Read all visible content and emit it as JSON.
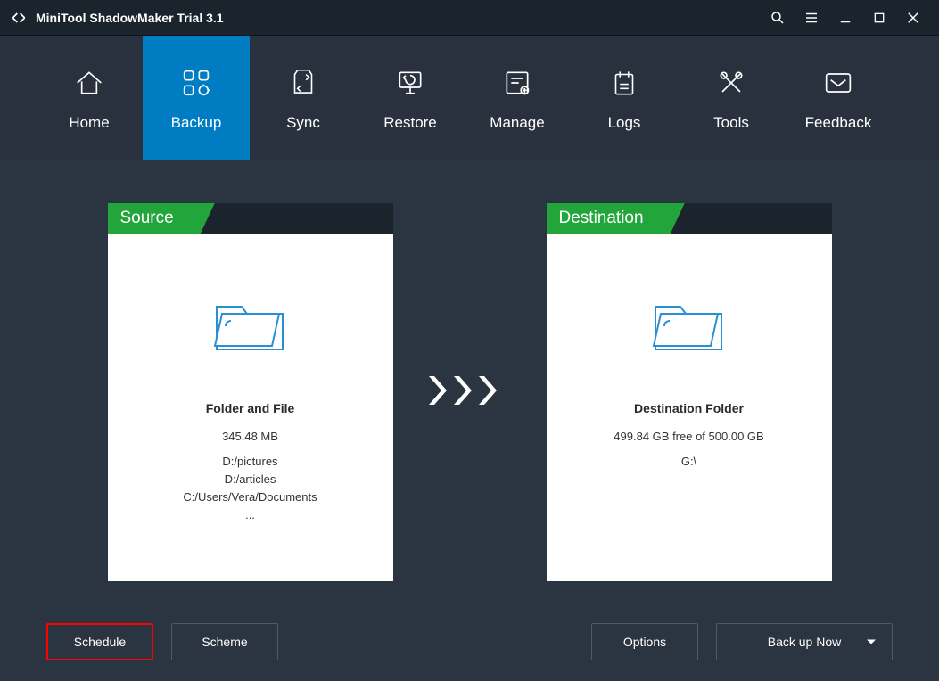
{
  "titlebar": {
    "title": "MiniTool ShadowMaker Trial 3.1"
  },
  "nav": {
    "tabs": [
      {
        "label": "Home"
      },
      {
        "label": "Backup"
      },
      {
        "label": "Sync"
      },
      {
        "label": "Restore"
      },
      {
        "label": "Manage"
      },
      {
        "label": "Logs"
      },
      {
        "label": "Tools"
      },
      {
        "label": "Feedback"
      }
    ]
  },
  "source": {
    "header": "Source",
    "title": "Folder and File",
    "size": "345.48 MB",
    "paths": [
      "D:/pictures",
      "D:/articles",
      "C:/Users/Vera/Documents",
      "..."
    ]
  },
  "destination": {
    "header": "Destination",
    "title": "Destination Folder",
    "free": "499.84 GB free of 500.00 GB",
    "drive": "G:\\"
  },
  "buttons": {
    "schedule": "Schedule",
    "scheme": "Scheme",
    "options": "Options",
    "backup_now": "Back up Now"
  }
}
